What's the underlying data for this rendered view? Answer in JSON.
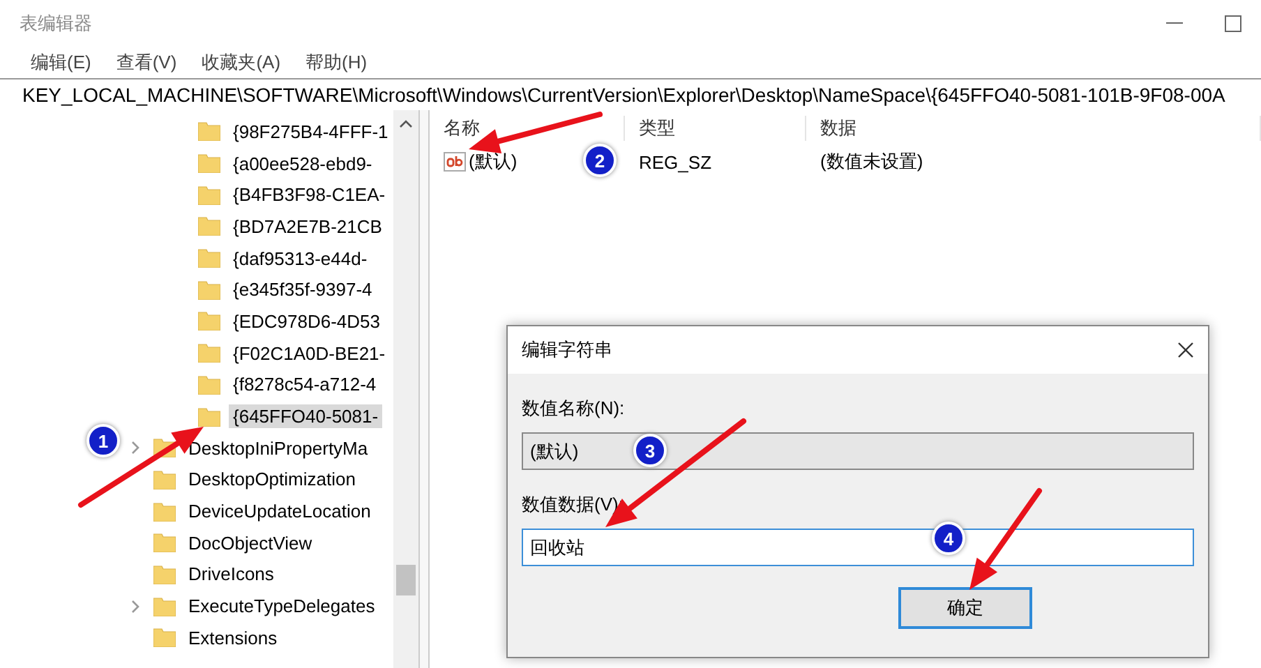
{
  "window": {
    "title": "表编辑器"
  },
  "menu": [
    {
      "label": "编辑(E)"
    },
    {
      "label": "查看(V)"
    },
    {
      "label": "收藏夹(A)"
    },
    {
      "label": "帮助(H)"
    }
  ],
  "address_bar": {
    "value": "KEY_LOCAL_MACHINE\\SOFTWARE\\Microsoft\\Windows\\CurrentVersion\\Explorer\\Desktop\\NameSpace\\{645FFO40-5081-101B-9F08-00A"
  },
  "tree": {
    "items": [
      {
        "children": [
          {
            "label": "{98F275B4-4FFF-1",
            "selected": false
          },
          {
            "label": "{a00ee528-ebd9-",
            "selected": false
          },
          {
            "label": "{B4FB3F98-C1EA-",
            "selected": false
          },
          {
            "label": "{BD7A2E7B-21CB",
            "selected": false
          },
          {
            "label": "{daf95313-e44d-",
            "selected": false
          },
          {
            "label": "{e345f35f-9397-4",
            "selected": false
          },
          {
            "label": "{EDC978D6-4D53",
            "selected": false
          },
          {
            "label": "{F02C1A0D-BE21-",
            "selected": false
          },
          {
            "label": "{f8278c54-a712-4",
            "selected": false
          },
          {
            "label": "{645FFO40-5081-",
            "selected": true
          }
        ]
      },
      {
        "label": "DesktopIniPropertyMa",
        "selected": false,
        "expandable": true
      },
      {
        "label": "DesktopOptimization",
        "selected": false,
        "expandable": false
      },
      {
        "label": "DeviceUpdateLocation",
        "selected": false,
        "expandable": false
      },
      {
        "label": "DocObjectView",
        "selected": false,
        "expandable": false
      },
      {
        "label": "DriveIcons",
        "selected": false,
        "expandable": false
      },
      {
        "label": "ExecuteTypeDelegates",
        "selected": false,
        "expandable": true
      },
      {
        "label": "Extensions",
        "selected": false,
        "expandable": false
      }
    ]
  },
  "values_list": {
    "columns": [
      "名称",
      "类型",
      "数据"
    ],
    "rows": [
      {
        "name": "(默认)",
        "type": "REG_SZ",
        "data": "(数值未设置)"
      }
    ]
  },
  "dialog": {
    "title": "编辑字符串",
    "name_label": "数值名称(N):",
    "name_value": "(默认)",
    "data_label": "数值数据(V):",
    "data_value": "回收站",
    "buttons": [
      {
        "label": "确定"
      }
    ]
  },
  "annotations": [
    {
      "number": "1"
    },
    {
      "number": "2"
    },
    {
      "number": "3"
    },
    {
      "number": "4"
    }
  ]
}
